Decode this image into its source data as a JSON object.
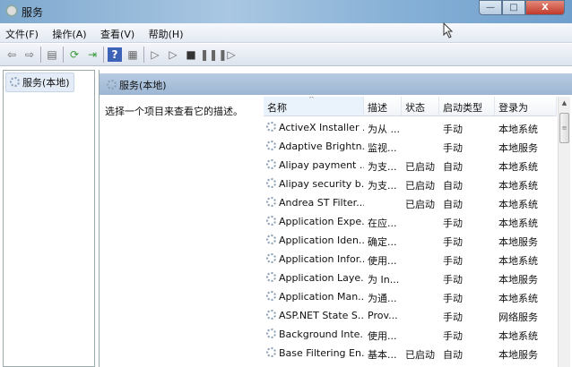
{
  "window": {
    "title": "服务",
    "minimize": "—",
    "maximize": "□",
    "close": "X"
  },
  "menu": [
    "文件(F)",
    "操作(A)",
    "查看(V)",
    "帮助(H)"
  ],
  "toolbar": {
    "icons": [
      "back-icon",
      "forward-icon",
      "show-hide-console-tree-icon",
      "refresh-icon",
      "export-list-icon",
      "help-icon",
      "properties-icon",
      "start-icon",
      "start-alt-icon",
      "stop-icon",
      "pause-icon",
      "resume-icon"
    ],
    "glyphs": [
      "⇦",
      "⇨",
      "▤",
      "⟳",
      "⇥",
      "?",
      "▦",
      "▷",
      "▷",
      "■",
      "❚❚",
      "❚▷"
    ]
  },
  "tree": {
    "item": "服务(本地)"
  },
  "main": {
    "header": "服务(本地)",
    "description": "选择一个项目来查看它的描述。"
  },
  "columns": [
    "名称",
    "描述",
    "状态",
    "启动类型",
    "登录为"
  ],
  "rows": [
    [
      "ActiveX Installer ...",
      "为从 ...",
      "",
      "手动",
      "本地系统"
    ],
    [
      "Adaptive Brightn...",
      "监视...",
      "",
      "手动",
      "本地服务"
    ],
    [
      "Alipay payment ...",
      "为支...",
      "已启动",
      "自动",
      "本地系统"
    ],
    [
      "Alipay security b...",
      "为支...",
      "已启动",
      "自动",
      "本地系统"
    ],
    [
      "Andrea ST Filter...",
      "",
      "已启动",
      "自动",
      "本地系统"
    ],
    [
      "Application Expe...",
      "在应...",
      "",
      "手动",
      "本地系统"
    ],
    [
      "Application Iden...",
      "确定...",
      "",
      "手动",
      "本地服务"
    ],
    [
      "Application Infor...",
      "使用...",
      "",
      "手动",
      "本地系统"
    ],
    [
      "Application Laye...",
      "为 In...",
      "",
      "手动",
      "本地服务"
    ],
    [
      "Application Man...",
      "为通...",
      "",
      "手动",
      "本地系统"
    ],
    [
      "ASP.NET State S...",
      "Prov...",
      "",
      "手动",
      "网络服务"
    ],
    [
      "Background Inte...",
      "使用...",
      "",
      "手动",
      "本地系统"
    ],
    [
      "Base Filtering En...",
      "基本...",
      "已启动",
      "自动",
      "本地服务"
    ]
  ]
}
